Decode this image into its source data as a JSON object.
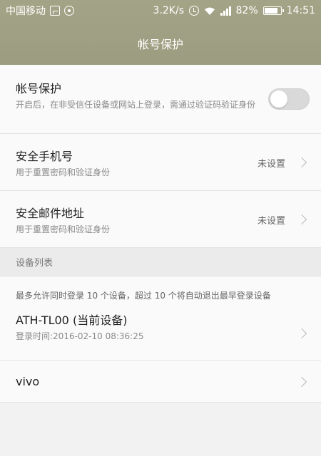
{
  "status_bar": {
    "carrier": "中国移动",
    "speed": "3.2K/s",
    "battery": "82%",
    "battery_level": 0.82,
    "time": "14:51",
    "icons": [
      "sim-box-icon",
      "compass-icon",
      "alarm-icon",
      "wifi-icon",
      "signal-icon",
      "battery-icon"
    ]
  },
  "header": {
    "title": "帐号保护"
  },
  "account_protection": {
    "title": "帐号保护",
    "description": "开启后，在非受信任设备或网站上登录，需通过验证码验证身份",
    "enabled": false
  },
  "security_phone": {
    "title": "安全手机号",
    "subtitle": "用于重置密码和验证身份",
    "value": "未设置"
  },
  "security_email": {
    "title": "安全邮件地址",
    "subtitle": "用于重置密码和验证身份",
    "value": "未设置"
  },
  "device_list": {
    "header": "设备列表",
    "hint": "最多允许同时登录 10 个设备，超过 10 个将自动退出最早登录设备",
    "devices": [
      {
        "name": "ATH-TL00 (当前设备)",
        "login_time": "登录时间:2016-02-10 08:36:25"
      },
      {
        "name": "vivo",
        "login_time": ""
      }
    ]
  },
  "colors": {
    "header_bg": "#9f a084",
    "page_bg": "#f2f2f2",
    "row_bg": "#fafafa",
    "toggle_off": "#d9d9d9"
  }
}
